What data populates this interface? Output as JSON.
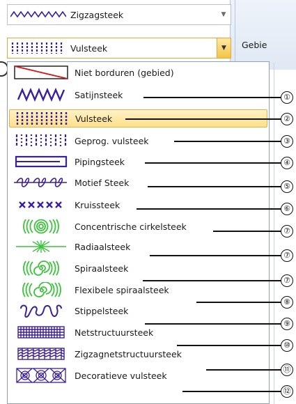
{
  "background": {
    "panel_label": "Gebie"
  },
  "combo_top": {
    "label": "Zigzagsteek",
    "icon": "zigzag-stitch-icon"
  },
  "combo_current": {
    "label": "Vulsteek",
    "icon": "fill-stitch-icon"
  },
  "dropdown": {
    "items": [
      {
        "label": "Niet borduren (gebied)",
        "icon": "no-sew-area-icon",
        "callout": ""
      },
      {
        "label": "Satijnsteek",
        "icon": "satin-stitch-icon",
        "callout": "①"
      },
      {
        "label": "Vulsteek",
        "icon": "fill-stitch-icon",
        "callout": "②",
        "selected": true
      },
      {
        "label": "Geprog. vulsteek",
        "icon": "programmed-fill-icon",
        "callout": "③"
      },
      {
        "label": "Pipingsteek",
        "icon": "piping-stitch-icon",
        "callout": "④"
      },
      {
        "label": "Motief Steek",
        "icon": "motif-stitch-icon",
        "callout": "⑤"
      },
      {
        "label": "Kruissteek",
        "icon": "cross-stitch-icon",
        "callout": "⑥"
      },
      {
        "label": "Concentrische cirkelsteek",
        "icon": "concentric-circle-icon",
        "callout": "⑦"
      },
      {
        "label": "Radiaalsteek",
        "icon": "radial-stitch-icon",
        "callout": "⑦"
      },
      {
        "label": "Spiraalsteek",
        "icon": "spiral-stitch-icon",
        "callout": "⑦"
      },
      {
        "label": "Flexibele spiraalsteek",
        "icon": "flexible-spiral-icon",
        "callout": "⑧"
      },
      {
        "label": "Stippelsteek",
        "icon": "stippling-stitch-icon",
        "callout": "⑨"
      },
      {
        "label": "Netstructuursteek",
        "icon": "net-structure-icon",
        "callout": "⑩"
      },
      {
        "label": "Zigzagnetstructuursteek",
        "icon": "zigzag-net-icon",
        "callout": "⑪"
      },
      {
        "label": "Decoratieve vulsteek",
        "icon": "decorative-fill-icon",
        "callout": "⑫"
      }
    ]
  },
  "colors": {
    "stitch": "#3a1f9e",
    "accent": "#f5c445",
    "no_sew_line": "#d11"
  }
}
